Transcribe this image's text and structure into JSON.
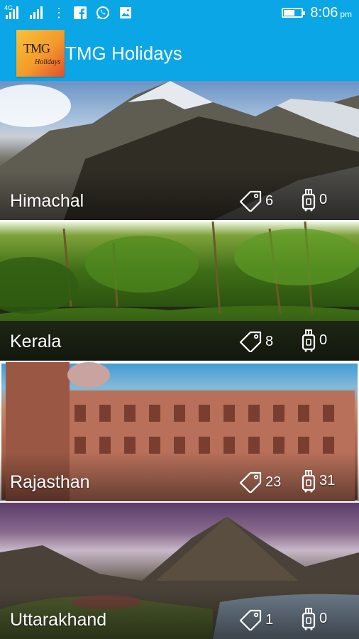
{
  "status_bar": {
    "network_label": "4G",
    "time": "8:06",
    "ampm": "pm",
    "battery_level": 0.7,
    "icons": [
      "signal-icon",
      "signal-icon",
      "more-vert-icon",
      "facebook-icon",
      "whatsapp-icon",
      "gallery-icon",
      "battery-icon"
    ]
  },
  "app_bar": {
    "title": "TMG Holidays",
    "logo_main": "TMG",
    "logo_sub": "Holidays",
    "bg_color": "#0aa6e6"
  },
  "destinations": [
    {
      "name": "Himachal",
      "tag_count": "6",
      "bag_count": "0"
    },
    {
      "name": "Kerala",
      "tag_count": "8",
      "bag_count": "0"
    },
    {
      "name": "Rajasthan",
      "tag_count": "23",
      "bag_count": "31"
    },
    {
      "name": "Uttarakhand",
      "tag_count": "1",
      "bag_count": "0"
    }
  ]
}
